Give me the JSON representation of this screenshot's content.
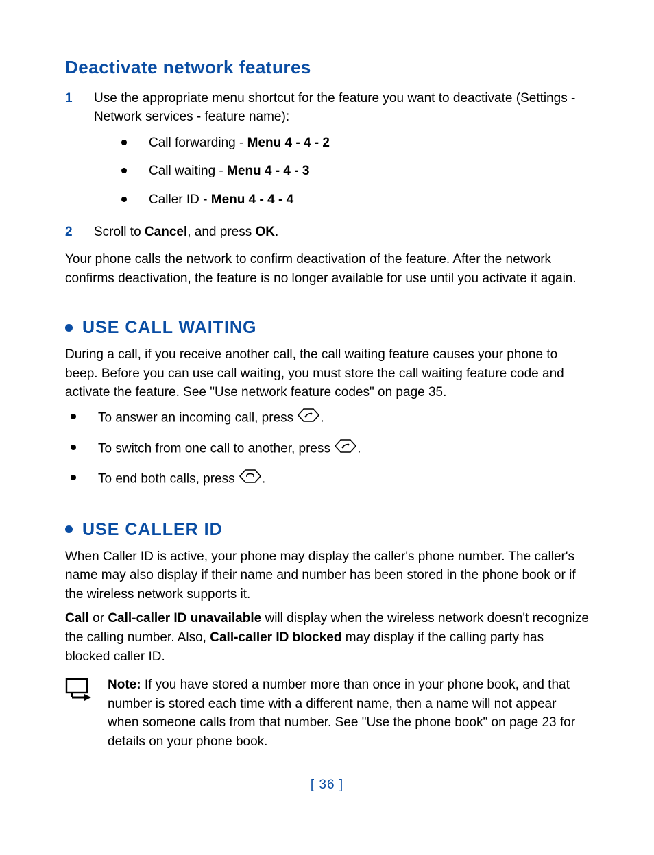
{
  "deactivate": {
    "heading": "Deactivate network features",
    "step1_num": "1",
    "step1_text": "Use the appropriate menu shortcut for the feature you want to deactivate (Settings - Network services - feature name):",
    "bullets": [
      {
        "label": "Call forwarding - ",
        "menu": "Menu 4 - 4 - 2"
      },
      {
        "label": "Call waiting - ",
        "menu": "Menu 4 - 4 - 3"
      },
      {
        "label": "Caller ID - ",
        "menu": "Menu 4 - 4 - 4"
      }
    ],
    "step2_num": "2",
    "step2_pre": "Scroll to ",
    "step2_b1": "Cancel",
    "step2_mid": ", and press ",
    "step2_b2": "OK",
    "step2_post": ".",
    "para": "Your phone calls the network to confirm deactivation of the feature. After the network confirms deactivation, the feature is no longer available for use until you activate it again."
  },
  "call_waiting": {
    "heading": "USE CALL WAITING",
    "para": "During a call, if you receive another call, the call waiting feature causes your phone to beep. Before you can use call waiting, you must store the call waiting feature code and activate the feature. See \"Use network feature codes\" on page 35.",
    "items": [
      {
        "pre": "To answer an incoming call, press ",
        "icon": "call-key-icon",
        "post": "."
      },
      {
        "pre": "To switch from one call to another, press ",
        "icon": "call-key-icon",
        "post": "."
      },
      {
        "pre": "To end both calls, press ",
        "icon": "end-key-icon",
        "post": "."
      }
    ]
  },
  "caller_id": {
    "heading": "USE CALLER ID",
    "para1": "When Caller ID is active, your phone may display the caller's phone number. The caller's name may also display if their name and number has been stored in the phone book or if the wireless network supports it.",
    "p2_b1": "Call",
    "p2_t1": " or ",
    "p2_b2": "Call-caller ID unavailable",
    "p2_t2": " will display when the wireless network doesn't recognize the calling number. Also, ",
    "p2_b3": "Call-caller ID blocked",
    "p2_t3": " may display if the calling party has blocked caller ID.",
    "note_label": "Note:",
    "note_text": " If you have stored a number more than once in your phone book, and that number is stored each time with a different name, then a name will not appear when someone calls from that number. See \"Use the phone book\" on page 23 for details on your phone book."
  },
  "footer": "[ 36 ]"
}
